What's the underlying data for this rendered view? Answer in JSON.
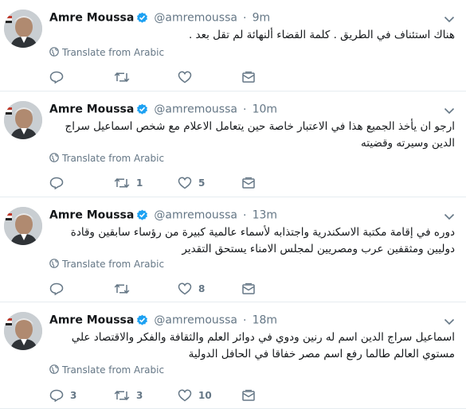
{
  "tweets": [
    {
      "name": "Amre Moussa",
      "handle": "@amremoussa",
      "time": "9m",
      "text": "هناك استئناف في الطريق . كلمة القضاء ألنهائة لم تقل بعد .",
      "translate": "Translate from Arabic",
      "replies": "",
      "retweets": "",
      "likes": ""
    },
    {
      "name": "Amre Moussa",
      "handle": "@amremoussa",
      "time": "10m",
      "text": "ارجو ان يأخذ الجميع هذا في الاعتبار خاصة حين يتعامل الاعلام مع شخص اسماعيل سراج الدين وسيرته وقضيته",
      "translate": "Translate from Arabic",
      "replies": "",
      "retweets": "1",
      "likes": "5"
    },
    {
      "name": "Amre Moussa",
      "handle": "@amremoussa",
      "time": "13m",
      "text": "دوره في إقامة مكتبة الاسكندرية واجتذابه لأسماء عالمية كبيرة من رؤساء سابقين وقادة دوليين ومثقفين عرب ومصريين لمجلس الامناء يستحق التقدير",
      "translate": "Translate from Arabic",
      "replies": "",
      "retweets": "",
      "likes": "8"
    },
    {
      "name": "Amre Moussa",
      "handle": "@amremoussa",
      "time": "18m",
      "text": "اسماعيل سراج الدين اسم له رنين ودوي في دوائر العلم والثقافة والفكر والاقتصاد علي مستوي العالم طالما رفع اسم مصر خفاقا في الحافل الدولية",
      "translate": "Translate from Arabic",
      "replies": "3",
      "retweets": "3",
      "likes": "10"
    }
  ],
  "colors": {
    "verified": "#1da1f2",
    "muted": "#657786",
    "border": "#e6ecf0"
  },
  "icons": [
    "globe-icon",
    "reply-icon",
    "retweet-icon",
    "like-icon",
    "dm-icon",
    "verified-badge-icon",
    "chevron-down-icon"
  ]
}
